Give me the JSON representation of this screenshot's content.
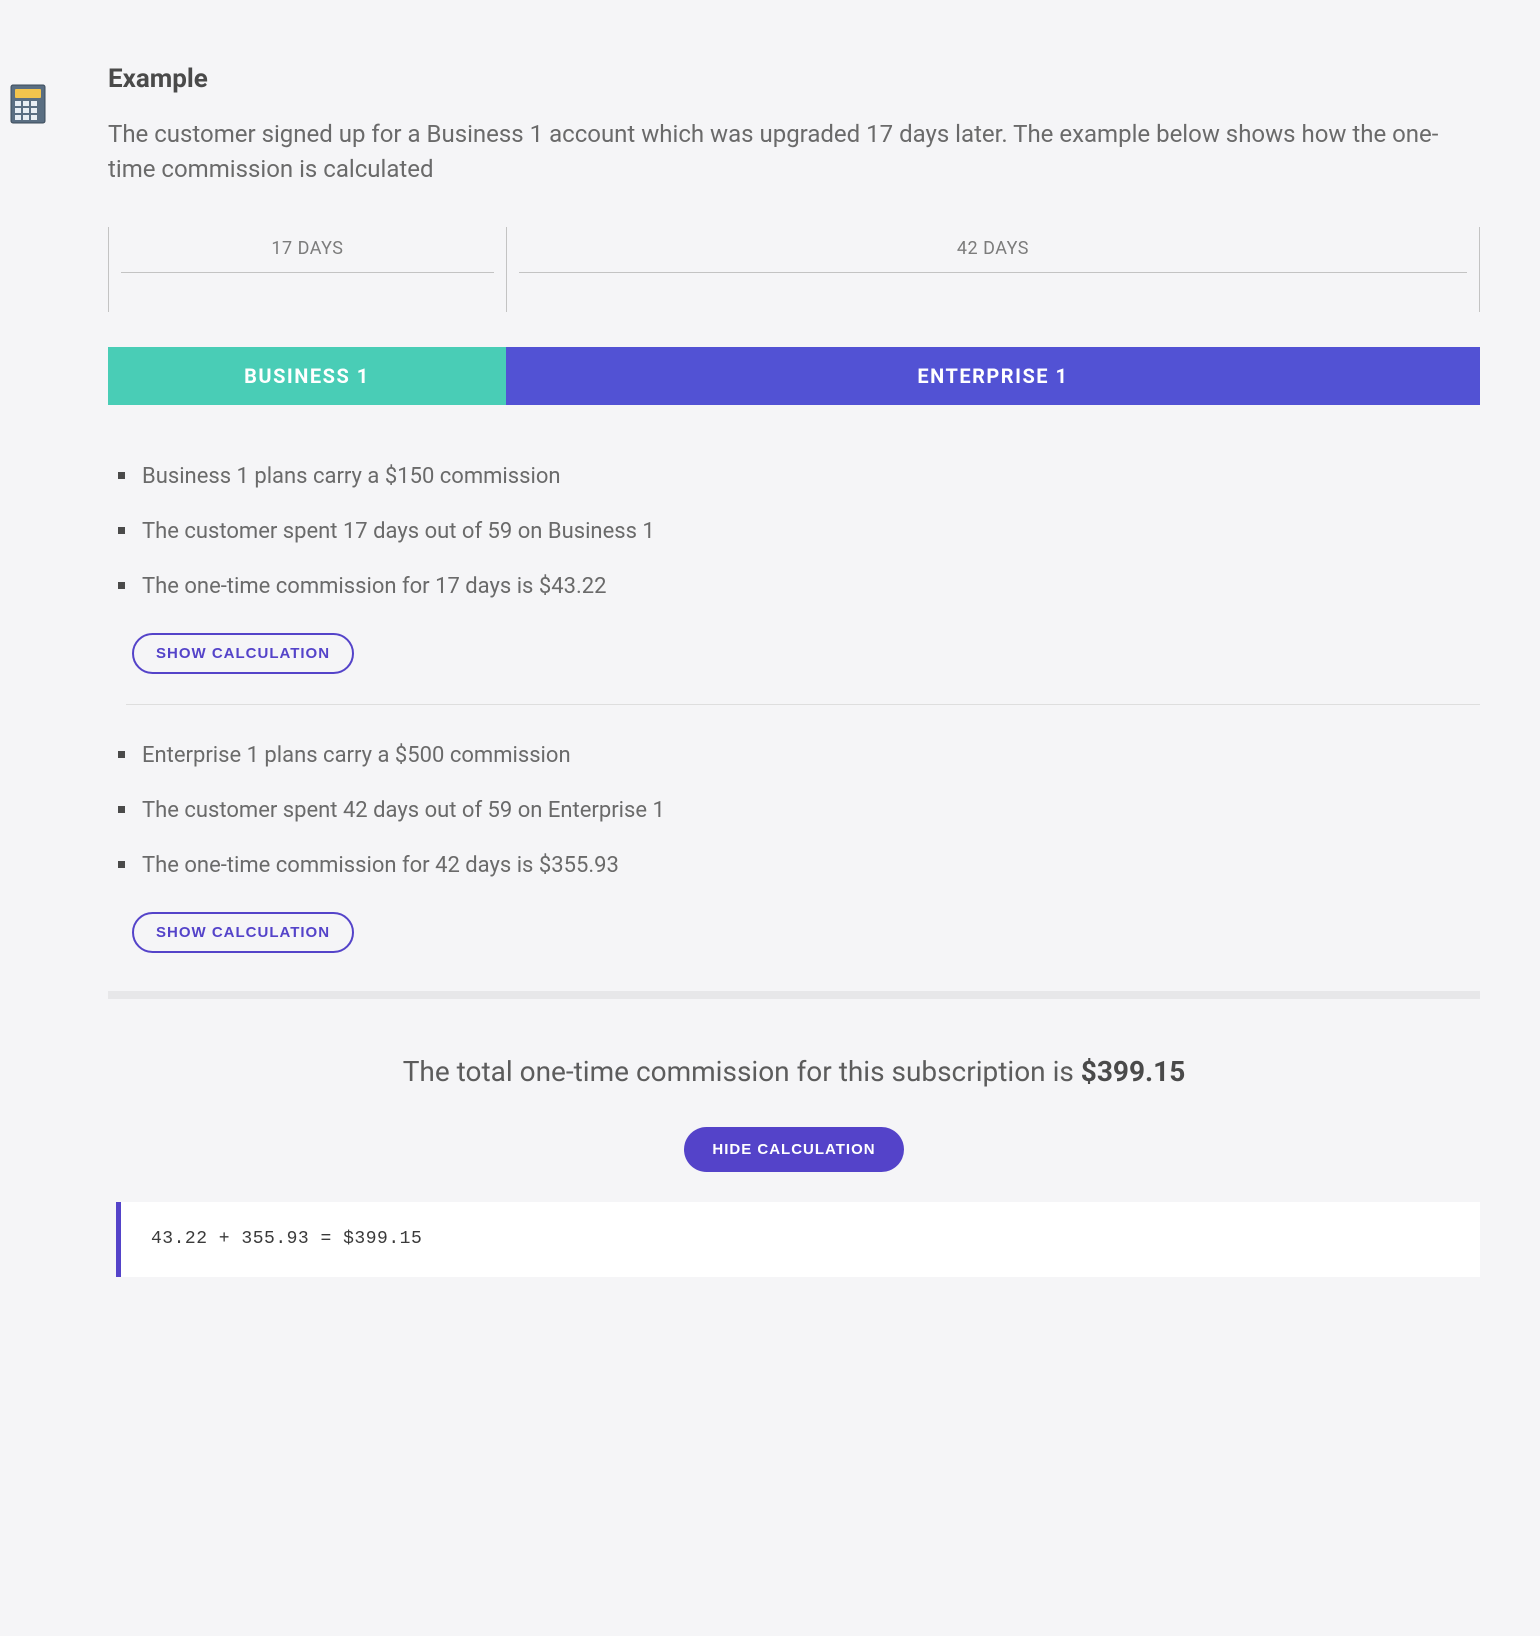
{
  "title": "Example",
  "intro": "The customer signed up for a Business 1 account which was upgraded 17 days later. The example below shows how the one-time commission is calculated",
  "timeline": {
    "seg1_label": "17 DAYS",
    "seg2_label": "42 DAYS"
  },
  "plans": {
    "business_label": "BUSINESS 1",
    "enterprise_label": "ENTERPRISE 1"
  },
  "business_list": {
    "item1": "Business 1 plans carry a $150 commission",
    "item2": "The customer spent 17 days out of 59 on Business 1",
    "item3": "The one-time commission for 17 days is $43.22",
    "show_calc_label": "SHOW CALCULATION"
  },
  "enterprise_list": {
    "item1": "Enterprise 1 plans carry a $500 commission",
    "item2": "The customer spent 42 days out of 59 on Enterprise 1",
    "item3": "The one-time commission for 42 days is $355.93",
    "show_calc_label": "SHOW CALCULATION"
  },
  "total": {
    "prefix": "The total one-time commission for this subscription is ",
    "amount": "$399.15",
    "hide_calc_label": "HIDE CALCULATION",
    "calc_text": "43.22 + 355.93 = $399.15"
  }
}
